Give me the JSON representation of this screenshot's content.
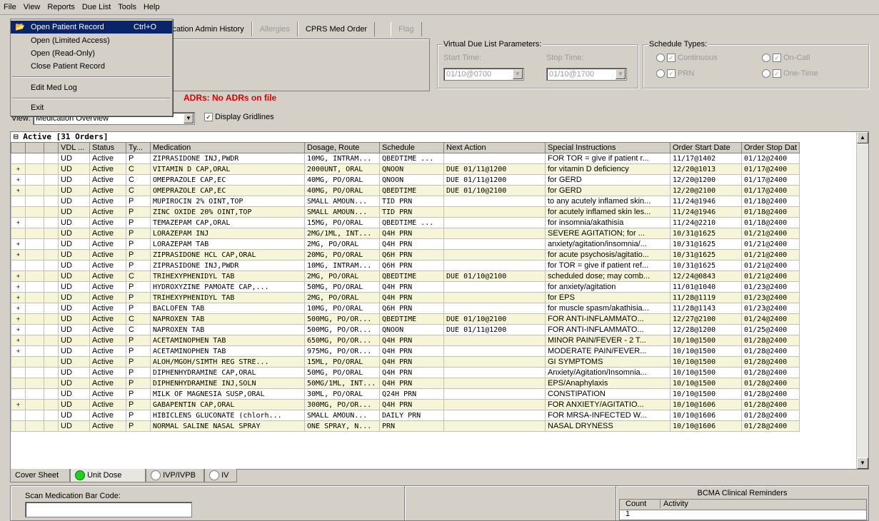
{
  "menubar": [
    "File",
    "View",
    "Reports",
    "Due List",
    "Tools",
    "Help"
  ],
  "toolbar": {
    "history_label": "ication Admin History",
    "allergies_label": "Allergies",
    "cprs_label": "CPRS Med Order",
    "flag_label": "Flag"
  },
  "file_menu": {
    "open_patient": "Open Patient Record",
    "open_shortcut": "Ctrl+O",
    "open_limited": "Open (Limited Access)",
    "open_readonly": "Open (Read-Only)",
    "close_patient": "Close Patient Record",
    "edit_med_log": "Edit Med Log",
    "exit": "Exit"
  },
  "due_list": {
    "title": "Virtual Due List Parameters:",
    "start_label": "Start Time:",
    "stop_label": "Stop Time:",
    "start_value": "01/10@0700",
    "stop_value": "01/10@1700"
  },
  "schedule_types": {
    "title": "Schedule Types:",
    "continuous": "Continuous",
    "on_call": "On-Call",
    "prn": "PRN",
    "one_time": "One-Time"
  },
  "adrs": "ADRs: No ADRs on file",
  "view": {
    "label": "View:",
    "value": "Medication Overview",
    "gridlines_label": "Display Gridlines"
  },
  "grid": {
    "group_title": "Active [31 Orders]",
    "columns": [
      "VDL ...",
      "Status",
      "Ty...",
      "Medication",
      "Dosage, Route",
      "Schedule",
      "Next Action",
      "Special Instructions",
      "Order Start Date",
      "Order Stop Dat"
    ],
    "rows": [
      {
        "exp": "",
        "vdl": "UD",
        "status": "Active",
        "type": "P",
        "med": "ZIPRASIDONE INJ,PWDR",
        "dose": "10MG, INTRAM...",
        "sched": "QBEDTIME ...",
        "next": "",
        "instr": "FOR TOR = give if patient r...",
        "start": "11/17@1402",
        "stop": "01/12@2400"
      },
      {
        "exp": "+",
        "vdl": "UD",
        "status": "Active",
        "type": "C",
        "med": "VITAMIN D CAP,ORAL",
        "dose": "2000UNT, ORAL",
        "sched": "QNOON",
        "next": "DUE 01/11@1200",
        "instr": "for vitamin D deficiency",
        "start": "12/20@1013",
        "stop": "01/17@2400"
      },
      {
        "exp": "+",
        "vdl": "UD",
        "status": "Active",
        "type": "C",
        "med": "OMEPRAZOLE CAP,EC",
        "dose": "40MG, PO/ORAL",
        "sched": "QNOON",
        "next": "DUE 01/11@1200",
        "instr": "for GERD",
        "start": "12/20@1200",
        "stop": "01/17@2400"
      },
      {
        "exp": "+",
        "vdl": "UD",
        "status": "Active",
        "type": "C",
        "med": "OMEPRAZOLE CAP,EC",
        "dose": "40MG, PO/ORAL",
        "sched": "QBEDTIME",
        "next": "DUE 01/10@2100",
        "instr": "for GERD",
        "start": "12/20@2100",
        "stop": "01/17@2400"
      },
      {
        "exp": "",
        "vdl": "UD",
        "status": "Active",
        "type": "P",
        "med": "MUPIROCIN 2% OINT,TOP",
        "dose": "SMALL AMOUN...",
        "sched": "TID PRN",
        "next": "",
        "instr": "to any acutely inflamed skin...",
        "start": "11/24@1946",
        "stop": "01/18@2400"
      },
      {
        "exp": "",
        "vdl": "UD",
        "status": "Active",
        "type": "P",
        "med": "ZINC OXIDE 20% OINT,TOP",
        "dose": "SMALL AMOUN...",
        "sched": "TID PRN",
        "next": "",
        "instr": "for acutely inflamed skin les...",
        "start": "11/24@1946",
        "stop": "01/18@2400"
      },
      {
        "exp": "+",
        "vdl": "UD",
        "status": "Active",
        "type": "P",
        "med": "TEMAZEPAM CAP,ORAL",
        "dose": "15MG, PO/ORAL",
        "sched": "QBEDTIME ...",
        "next": "",
        "instr": "for insomnia/akathisia",
        "start": "11/24@2210",
        "stop": "01/18@2400"
      },
      {
        "exp": "",
        "vdl": "UD",
        "status": "Active",
        "type": "P",
        "med": "LORAZEPAM INJ",
        "dose": "2MG/1ML, INT...",
        "sched": "Q4H PRN",
        "next": "",
        "instr": "SEVERE AGITATION; for ...",
        "start": "10/31@1625",
        "stop": "01/21@2400"
      },
      {
        "exp": "+",
        "vdl": "UD",
        "status": "Active",
        "type": "P",
        "med": "LORAZEPAM TAB",
        "dose": "2MG, PO/ORAL",
        "sched": "Q4H PRN",
        "next": "",
        "instr": "anxiety/agitation/insomnia/...",
        "start": "10/31@1625",
        "stop": "01/21@2400"
      },
      {
        "exp": "+",
        "vdl": "UD",
        "status": "Active",
        "type": "P",
        "med": "ZIPRASIDONE HCL CAP,ORAL",
        "dose": "20MG, PO/ORAL",
        "sched": "Q6H PRN",
        "next": "",
        "instr": "for acute psychosis/agitatio...",
        "start": "10/31@1625",
        "stop": "01/21@2400"
      },
      {
        "exp": "",
        "vdl": "UD",
        "status": "Active",
        "type": "P",
        "med": "ZIPRASIDONE INJ,PWDR",
        "dose": "10MG, INTRAM...",
        "sched": "Q6H PRN",
        "next": "",
        "instr": "for TOR = give if patient ref...",
        "start": "10/31@1625",
        "stop": "01/21@2400"
      },
      {
        "exp": "+",
        "vdl": "UD",
        "status": "Active",
        "type": "C",
        "med": "TRIHEXYPHENIDYL TAB",
        "dose": "2MG, PO/ORAL",
        "sched": "QBEDTIME",
        "next": "DUE 01/10@2100",
        "instr": "scheduled dose; may comb...",
        "start": "12/24@0843",
        "stop": "01/21@2400"
      },
      {
        "exp": "+",
        "vdl": "UD",
        "status": "Active",
        "type": "P",
        "med": "HYDROXYZINE PAMOATE CAP,...",
        "dose": "50MG, PO/ORAL",
        "sched": "Q4H PRN",
        "next": "",
        "instr": "for anxiety/agitation",
        "start": "11/01@1040",
        "stop": "01/23@2400"
      },
      {
        "exp": "+",
        "vdl": "UD",
        "status": "Active",
        "type": "P",
        "med": "TRIHEXYPHENIDYL TAB",
        "dose": "2MG, PO/ORAL",
        "sched": "Q4H PRN",
        "next": "",
        "instr": "for EPS",
        "start": "11/28@1119",
        "stop": "01/23@2400"
      },
      {
        "exp": "+",
        "vdl": "UD",
        "status": "Active",
        "type": "P",
        "med": "BACLOFEN TAB",
        "dose": "10MG, PO/ORAL",
        "sched": "Q6H PRN",
        "next": "",
        "instr": "for muscle spasm/akathisia...",
        "start": "11/28@1143",
        "stop": "01/23@2400"
      },
      {
        "exp": "+",
        "vdl": "UD",
        "status": "Active",
        "type": "C",
        "med": "NAPROXEN TAB",
        "dose": "500MG, PO/OR...",
        "sched": "QBEDTIME",
        "next": "DUE 01/10@2100",
        "instr": "FOR ANTI-INFLAMMATO...",
        "start": "12/27@2100",
        "stop": "01/24@2400"
      },
      {
        "exp": "+",
        "vdl": "UD",
        "status": "Active",
        "type": "C",
        "med": "NAPROXEN TAB",
        "dose": "500MG, PO/OR...",
        "sched": "QNOON",
        "next": "DUE 01/11@1200",
        "instr": "FOR ANTI-INFLAMMATO...",
        "start": "12/28@1200",
        "stop": "01/25@2400"
      },
      {
        "exp": "+",
        "vdl": "UD",
        "status": "Active",
        "type": "P",
        "med": "ACETAMINOPHEN TAB",
        "dose": "650MG, PO/OR...",
        "sched": "Q4H PRN",
        "next": "",
        "instr": "MINOR PAIN/FEVER - 2 T...",
        "start": "10/10@1500",
        "stop": "01/28@2400"
      },
      {
        "exp": "+",
        "vdl": "UD",
        "status": "Active",
        "type": "P",
        "med": "ACETAMINOPHEN TAB",
        "dose": "975MG, PO/OR...",
        "sched": "Q4H PRN",
        "next": "",
        "instr": "MODERATE PAIN/FEVER...",
        "start": "10/10@1500",
        "stop": "01/28@2400"
      },
      {
        "exp": "",
        "vdl": "UD",
        "status": "Active",
        "type": "P",
        "med": "ALOH/MGOH/SIMTH REG STRE...",
        "dose": "15ML, PO/ORAL",
        "sched": "Q4H PRN",
        "next": "",
        "instr": "GI SYMPTOMS",
        "start": "10/10@1500",
        "stop": "01/28@2400"
      },
      {
        "exp": "",
        "vdl": "UD",
        "status": "Active",
        "type": "P",
        "med": "DIPHENHYDRAMINE CAP,ORAL",
        "dose": "50MG, PO/ORAL",
        "sched": "Q4H PRN",
        "next": "",
        "instr": "Anxiety/Agitation/Insomnia...",
        "start": "10/10@1500",
        "stop": "01/28@2400"
      },
      {
        "exp": "",
        "vdl": "UD",
        "status": "Active",
        "type": "P",
        "med": "DIPHENHYDRAMINE INJ,SOLN",
        "dose": "50MG/1ML, INT...",
        "sched": "Q4H PRN",
        "next": "",
        "instr": "EPS/Anaphylaxis",
        "start": "10/10@1500",
        "stop": "01/28@2400"
      },
      {
        "exp": "",
        "vdl": "UD",
        "status": "Active",
        "type": "P",
        "med": "MILK OF MAGNESIA SUSP,ORAL",
        "dose": "30ML, PO/ORAL",
        "sched": "Q24H PRN",
        "next": "",
        "instr": "CONSTIPATION",
        "start": "10/10@1500",
        "stop": "01/28@2400"
      },
      {
        "exp": "+",
        "vdl": "UD",
        "status": "Active",
        "type": "P",
        "med": "GABAPENTIN CAP,ORAL",
        "dose": "300MG, PO/OR...",
        "sched": "Q4H PRN",
        "next": "",
        "instr": "FOR ANXIETY/AGITATIO...",
        "start": "10/10@1606",
        "stop": "01/28@2400"
      },
      {
        "exp": "",
        "vdl": "UD",
        "status": "Active",
        "type": "P",
        "med": "HIBICLENS GLUCONATE (chlorh...",
        "dose": "SMALL AMOUN...",
        "sched": "DAILY PRN",
        "next": "",
        "instr": "FOR MRSA-INFECTED W...",
        "start": "10/10@1606",
        "stop": "01/28@2400"
      },
      {
        "exp": "",
        "vdl": "UD",
        "status": "Active",
        "type": "P",
        "med": "NORMAL SALINE NASAL SPRAY",
        "dose": "ONE SPRAY, N...",
        "sched": "PRN",
        "next": "",
        "instr": "NASAL DRYNESS",
        "start": "10/10@1606",
        "stop": "01/28@2400"
      }
    ]
  },
  "tabs": {
    "cover_sheet": "Cover Sheet",
    "unit_dose": "Unit Dose",
    "ivp_ivpb": "IVP/IVPB",
    "iv": "IV"
  },
  "scan": {
    "label": "Scan Medication Bar Code:",
    "value": ""
  },
  "reminders": {
    "title": "BCMA Clinical Reminders",
    "col_count": "Count",
    "col_activity": "Activity",
    "count": "1"
  },
  "colors": {
    "adr_red": "#e00000",
    "alt_row": "#f7f5d8",
    "unit_dose_green": "#1fd01f"
  }
}
